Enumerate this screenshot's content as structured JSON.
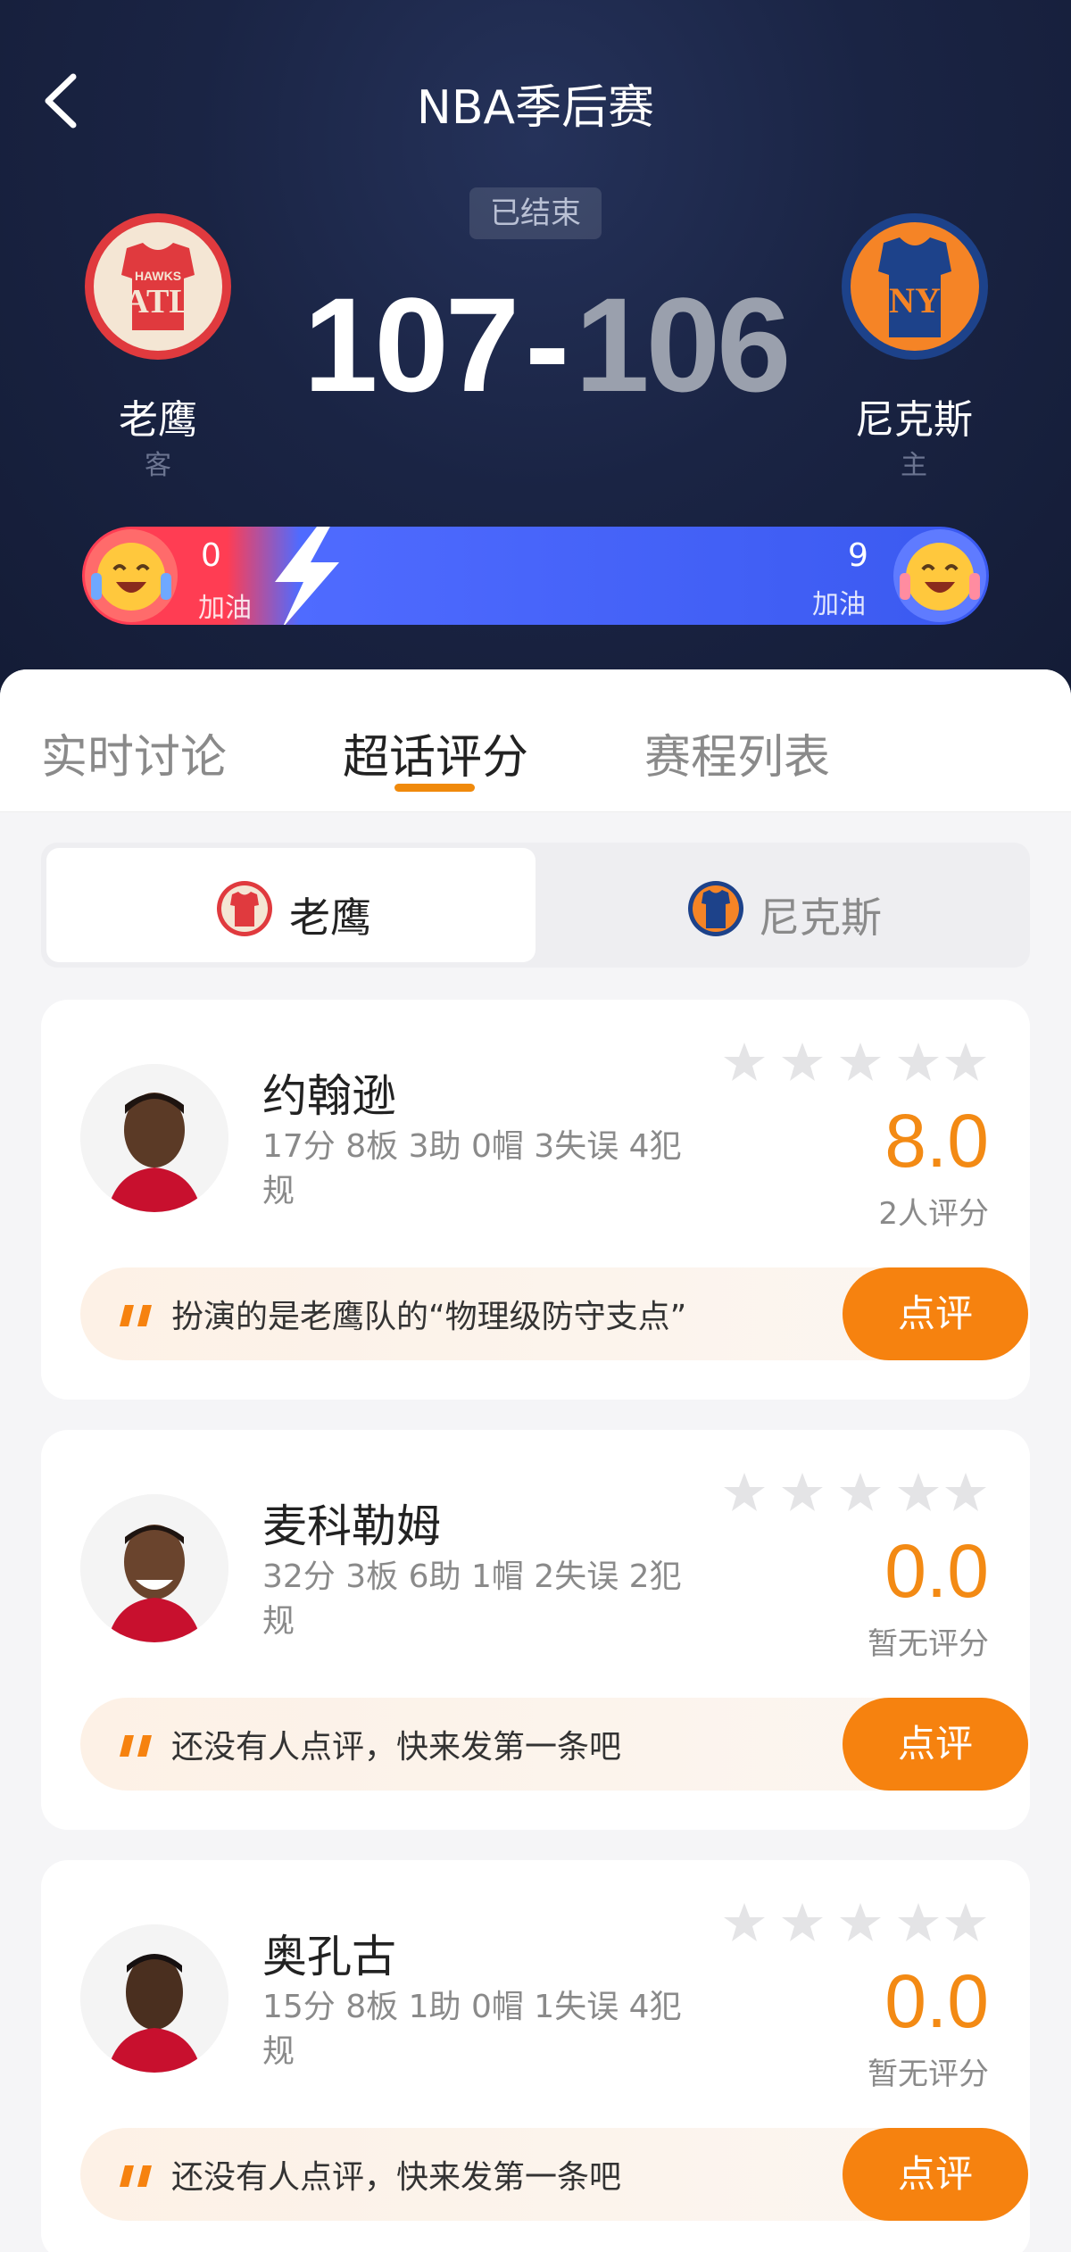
{
  "header": {
    "title": "NBA季后赛",
    "status": "已结束",
    "score": {
      "home": "107",
      "separator": "-",
      "away": "106"
    },
    "team_left": {
      "name": "老鹰",
      "role": "客",
      "logo_text": "ATL",
      "logo_sub": "HAWKS",
      "color": "#e03a3e"
    },
    "team_right": {
      "name": "尼克斯",
      "role": "主",
      "logo_text": "NY",
      "color": "#f58426"
    },
    "cheer": {
      "left_count": "0",
      "left_label": "加油",
      "right_count": "9",
      "right_label": "加油"
    }
  },
  "tabs": [
    {
      "label": "实时讨论"
    },
    {
      "label": "超话评分"
    },
    {
      "label": "赛程列表"
    }
  ],
  "team_switch": [
    {
      "label": "老鹰"
    },
    {
      "label": "尼克斯"
    }
  ],
  "players": [
    {
      "name": "约翰逊",
      "stats": "17分 8板 3助 0帽 3失误 4犯规",
      "rating": "8.0",
      "rating_count": "2人评分",
      "comment": "扮演的是老鹰队的“物理级防守支点”",
      "button": "点评"
    },
    {
      "name": "麦科勒姆",
      "stats": "32分 3板 6助 1帽 2失误 2犯规",
      "rating": "0.0",
      "rating_count": "暂无评分",
      "comment": "还没有人点评，快来发第一条吧",
      "button": "点评"
    },
    {
      "name": "奥孔古",
      "stats": "15分 8板 1助 0帽 1失误 4犯规",
      "rating": "0.0",
      "rating_count": "暂无评分",
      "comment": "还没有人点评，快来发第一条吧",
      "button": "点评"
    }
  ],
  "colors": {
    "accent": "#f6820f",
    "rating": "#f38a14",
    "cheer_red": "#ff3d53",
    "cheer_blue": "#3a59f0"
  }
}
